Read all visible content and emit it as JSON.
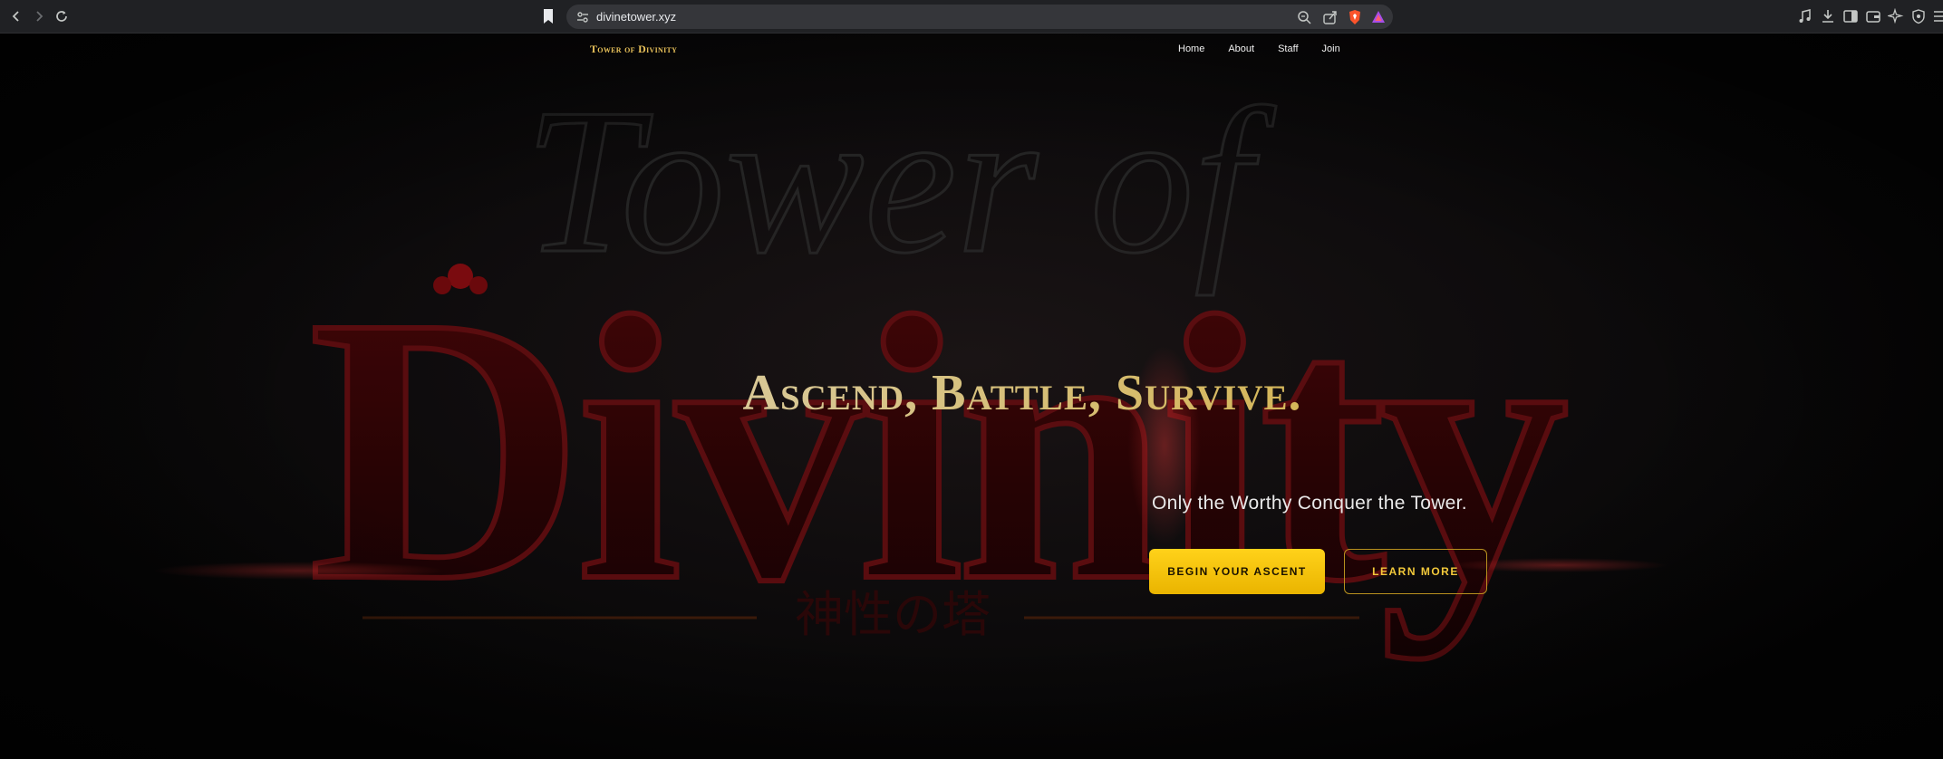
{
  "browser": {
    "url": "divinetower.xyz"
  },
  "site": {
    "logo": "Tower of Divinity",
    "nav": [
      "Home",
      "About",
      "Staff",
      "Join"
    ]
  },
  "hero": {
    "title_parts": [
      "Ascend,",
      "Battle,",
      "Survive."
    ],
    "tagline": "Only the Worthy Conquer the Tower.",
    "primary_button": "BEGIN YOUR ASCENT",
    "secondary_button": "LEARN MORE",
    "background_art_word": "Divinity",
    "background_script_word": "Tower of",
    "background_japanese": "神性の塔"
  },
  "colors": {
    "accent_gold": "#f5c20b",
    "dark_red": "#5a0a0c",
    "background": "#050505"
  }
}
